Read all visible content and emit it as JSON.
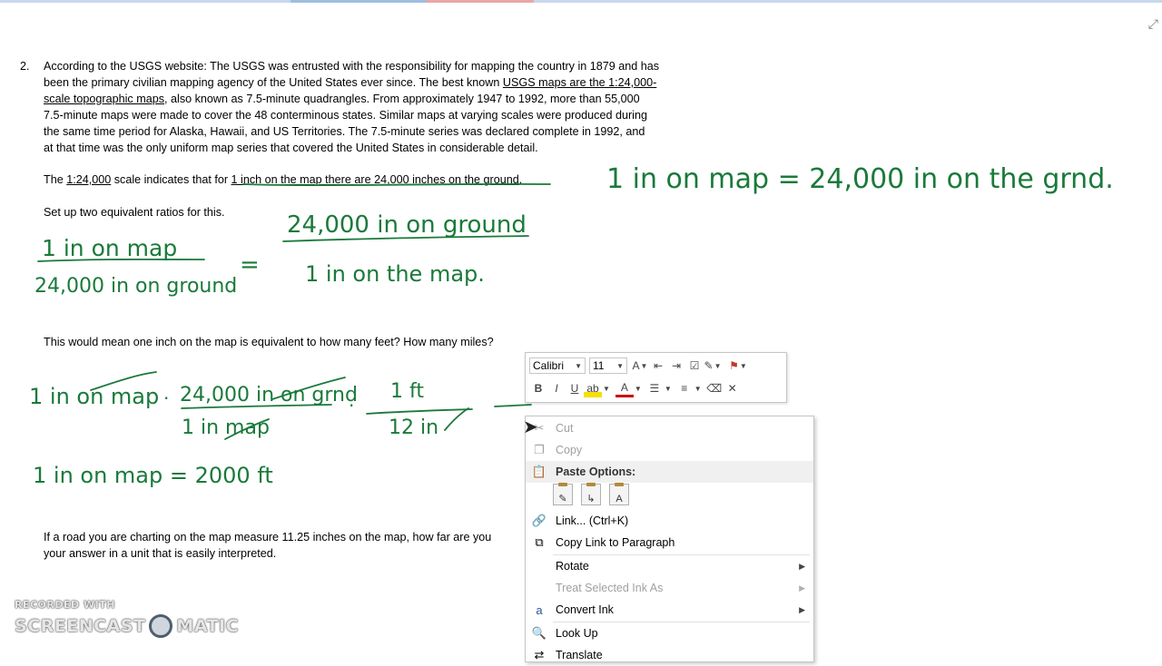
{
  "document": {
    "item_number": "2.",
    "paragraph_lines": [
      [
        {
          "t": "According to the USGS website: The USGS was entrusted with the responsibility for mapping the country in 1879 and has"
        }
      ],
      [
        {
          "t": "been the primary civilian mapping agency of the United States ever since. The best known "
        },
        {
          "t": "USGS maps are the 1:24,000-",
          "u": true
        }
      ],
      [
        {
          "t": "scale topographic maps",
          "u": true
        },
        {
          "t": ", also known as 7.5-minute quadrangles. From approximately 1947 to 1992, more than 55,000"
        }
      ],
      [
        {
          "t": "7.5-minute maps were made to cover the 48 conterminous states. Similar maps at varying scales were produced during"
        }
      ],
      [
        {
          "t": "the same time period for Alaska, Hawaii, and US Territories. The 7.5-minute series was declared complete in 1992, and"
        }
      ],
      [
        {
          "t": "at that time was the only uniform map series that covered the United States in considerable detail."
        }
      ]
    ],
    "scale_line": {
      "p1": "The ",
      "p2": "1:24,000",
      "p3": " scale indicates that for ",
      "p4": "1 inch on the map there are 24,000 inches on the ground",
      "p5": "."
    },
    "setup_line": "Set up two equivalent ratios for this.",
    "question_line": "This would mean one inch on the map is equivalent to how many feet? How many miles?",
    "road_line1": "If a road you are charting on the map measure 11.25 inches on the map, how far are you",
    "road_line2": "your answer in a unit that is easily interpreted."
  },
  "handwriting": {
    "eq_top": "1 in on map = 24,000 in on the grnd.",
    "ratio_left_num": "1 in on map",
    "ratio_left_den": "24,000 in on ground",
    "ratio_equals": "=",
    "ratio_right_num": "24,000 in on ground",
    "ratio_right_den": "1 in on the map.",
    "conv_a": "1 in on map",
    "conv_b_num": "24,000 in on grnd",
    "conv_b_den": "1 in map",
    "conv_c_num": "1 ft",
    "conv_c_den": "12 in",
    "answer": "1 in on map = 2000 ft"
  },
  "mini_toolbar": {
    "font_name": "Calibri",
    "font_size": "11",
    "bold": "B",
    "italic": "I",
    "underline": "U",
    "font_color_glyph": "A"
  },
  "context_menu": {
    "items": [
      {
        "label": "Cut",
        "icon": "scissors-icon",
        "disabled": true
      },
      {
        "label": "Copy",
        "icon": "copy-icon",
        "disabled": true
      },
      {
        "label": "Paste Options:",
        "icon": "clipboard-icon",
        "header": true
      },
      {
        "label": "Link...  (Ctrl+K)",
        "icon": "link-icon"
      },
      {
        "label": "Copy Link to Paragraph",
        "icon": "copy-link-icon"
      },
      {
        "label": "Rotate",
        "submenu": true
      },
      {
        "label": "Treat Selected Ink As",
        "submenu": true,
        "disabled": true
      },
      {
        "label": "Convert Ink",
        "icon": "convert-ink-icon",
        "submenu": true
      },
      {
        "label": "Look Up",
        "icon": "search-icon"
      },
      {
        "label": "Translate",
        "icon": "translate-icon"
      }
    ],
    "paste_icons": [
      "keep-formatting",
      "merge-formatting",
      "keep-text-only"
    ]
  },
  "watermark": {
    "line1": "RECORDED WITH",
    "line2a": "SCREENCAST",
    "line2b": "MATIC"
  },
  "colors": {
    "ink": "#1a7a3a",
    "menu_header_bg": "#f0f0f0",
    "disabled": "#a0a0a0"
  }
}
